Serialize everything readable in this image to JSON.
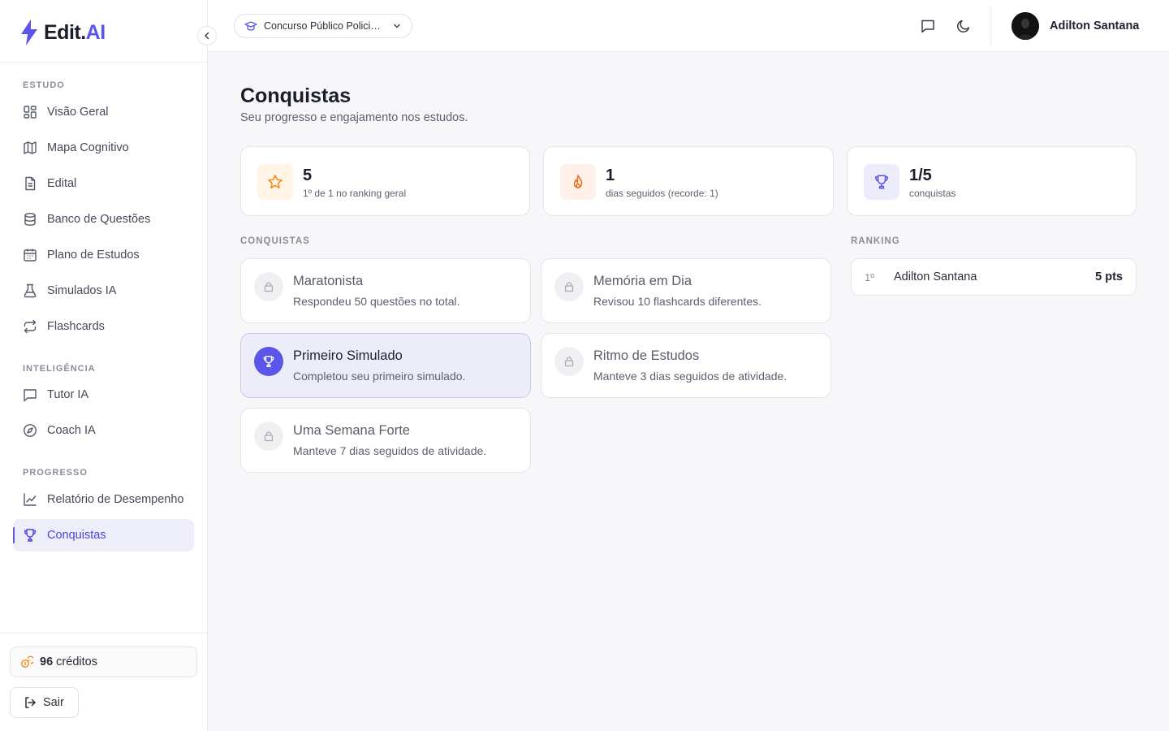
{
  "brand": {
    "name_main": "Edit.",
    "name_accent": "AI",
    "accent_color": "#5b56e8"
  },
  "sidebar": {
    "sections": [
      {
        "label": "ESTUDO"
      },
      {
        "label": "INTELIGÊNCIA"
      },
      {
        "label": "PROGRESSO"
      }
    ],
    "items": [
      {
        "label": "Visão Geral",
        "icon": "dashboard-icon"
      },
      {
        "label": "Mapa Cognitivo",
        "icon": "map-icon"
      },
      {
        "label": "Edital",
        "icon": "document-icon"
      },
      {
        "label": "Banco de Questões",
        "icon": "database-icon"
      },
      {
        "label": "Plano de Estudos",
        "icon": "calendar-icon"
      },
      {
        "label": "Simulados IA",
        "icon": "flask-icon"
      },
      {
        "label": "Flashcards",
        "icon": "repeat-icon"
      },
      {
        "label": "Tutor IA",
        "icon": "message-icon"
      },
      {
        "label": "Coach IA",
        "icon": "compass-icon"
      },
      {
        "label": "Relatório de Desempenho",
        "icon": "line-chart-icon"
      },
      {
        "label": "Conquistas",
        "icon": "trophy-icon",
        "active": true
      }
    ],
    "credits_value": "96",
    "credits_label": "créditos",
    "logout_label": "Sair"
  },
  "header": {
    "course": "Concurso Público Policia Civil",
    "user_name": "Adilton Santana"
  },
  "page": {
    "title": "Conquistas",
    "subtitle": "Seu progresso e engajamento nos estudos."
  },
  "stats": [
    {
      "value": "5",
      "caption": "1º de 1 no ranking geral",
      "icon": "star-icon",
      "color": "#f08a1c"
    },
    {
      "value": "1",
      "caption": "dias seguidos (recorde: 1)",
      "icon": "flame-icon",
      "color": "#ef6a1a"
    },
    {
      "value": "1/5",
      "caption": "conquistas",
      "icon": "trophy-icon",
      "color": "#5b56e8"
    }
  ],
  "achievements_label": "CONQUISTAS",
  "achievements": [
    {
      "title": "Maratonista",
      "description": "Respondeu 50 questões no total.",
      "unlocked": false
    },
    {
      "title": "Memória em Dia",
      "description": "Revisou 10 flashcards diferentes.",
      "unlocked": false
    },
    {
      "title": "Primeiro Simulado",
      "description": "Completou seu primeiro simulado.",
      "unlocked": true
    },
    {
      "title": "Ritmo de Estudos",
      "description": "Manteve 3 dias seguidos de atividade.",
      "unlocked": false
    },
    {
      "title": "Uma Semana Forte",
      "description": "Manteve 7 dias seguidos de atividade.",
      "unlocked": false
    }
  ],
  "ranking_label": "RANKING",
  "ranking": [
    {
      "position": "1º",
      "name": "Adilton Santana",
      "points": "5 pts"
    }
  ]
}
